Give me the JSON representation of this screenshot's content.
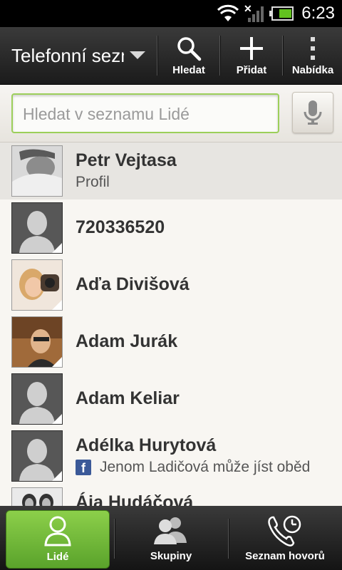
{
  "status_bar": {
    "time": "6:23"
  },
  "action_bar": {
    "title": "Telefonní seznam",
    "search_label": "Hledat",
    "add_label": "Přidat",
    "menu_label": "Nabídka"
  },
  "search": {
    "placeholder": "Hledat v seznamu Lidé"
  },
  "contacts": [
    {
      "name": "Petr Vejtasa",
      "subtitle": "Profil"
    },
    {
      "name": "720336520"
    },
    {
      "name": "Aďa Divišová"
    },
    {
      "name": "Adam Jurák"
    },
    {
      "name": "Adam Keliar"
    },
    {
      "name": "Adélka Hurytová",
      "status": "Jenom  Ladičová může jíst oběd"
    },
    {
      "name": "Ája Hudáčová"
    }
  ],
  "tabs": [
    {
      "label": "Lidé"
    },
    {
      "label": "Skupiny"
    },
    {
      "label": "Seznam hovorů"
    }
  ],
  "colors": {
    "accent_green": "#7bc043",
    "facebook_blue": "#3b5998"
  }
}
